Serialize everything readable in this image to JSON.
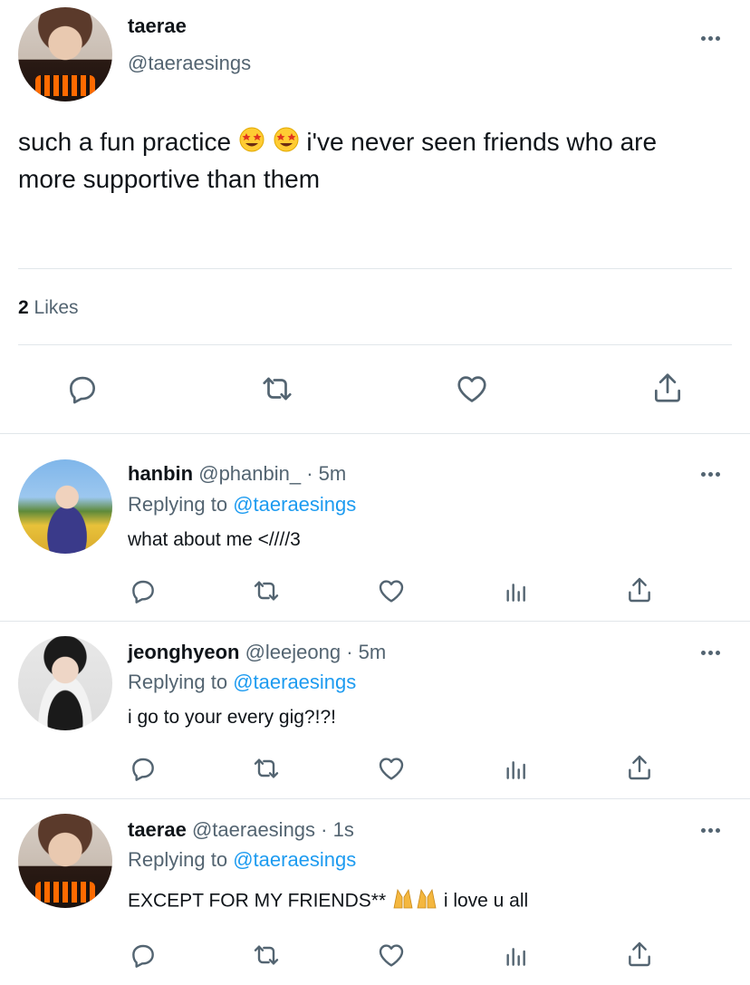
{
  "main_tweet": {
    "display_name": "taerae",
    "handle": "@taeraesings",
    "text_line1": "such a fun practice",
    "text_line1_rest": "i've never seen friends who are",
    "text_line2": "more supportive than them",
    "likes_count": "2",
    "likes_label": "Likes"
  },
  "replies": [
    {
      "display_name": "hanbin",
      "handle": "@phanbin_",
      "time": "· 5m",
      "replying_prefix": "Replying to",
      "replying_to": "@taeraesings",
      "text": "what about me <////3"
    },
    {
      "display_name": "jeonghyeon",
      "handle": "@leejeong",
      "time": "· 5m",
      "replying_prefix": "Replying to",
      "replying_to": "@taeraesings",
      "text": "i go to your every gig?!?!"
    },
    {
      "display_name": "taerae",
      "handle": "@taeraesings",
      "time": "· 1s",
      "replying_prefix": "Replying to",
      "replying_to": "@taeraesings",
      "text_before": "EXCEPT FOR MY FRIENDS**",
      "text_after": "i love u all"
    }
  ],
  "icons": {
    "reply": "reply-icon",
    "retweet": "retweet-icon",
    "like": "heart-icon",
    "share": "share-icon",
    "analytics": "analytics-icon",
    "more": "more-icon",
    "emoji_main": "star-struck-emoji",
    "emoji_reply": "folded-hands-emoji"
  },
  "colors": {
    "text": "#0f1419",
    "secondary": "#536471",
    "link": "#1d9bf0",
    "divider": "#e1e6ea"
  }
}
